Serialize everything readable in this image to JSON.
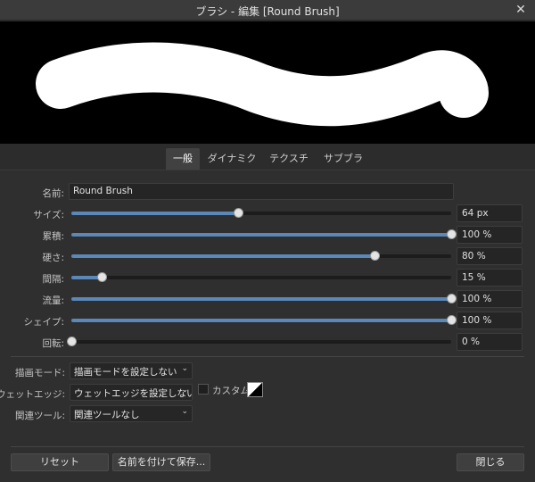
{
  "window": {
    "title": "ブラシ - 編集 [Round Brush]",
    "close_glyph": "✕"
  },
  "preview": {
    "stroke_color": "#ffffff",
    "background_color": "#000000"
  },
  "tabs": [
    {
      "label": "一般",
      "active": true
    },
    {
      "label": "ダイナミクス",
      "active": false
    },
    {
      "label": "テクスチャ",
      "active": false
    },
    {
      "label": "サブブラシ",
      "active": false
    }
  ],
  "general": {
    "name_label": "名前:",
    "name_value": "Round Brush",
    "sliders": [
      {
        "label": "サイズ:",
        "value": "64 px",
        "fraction": 0.44
      },
      {
        "label": "累積:",
        "value": "100 %",
        "fraction": 1.0
      },
      {
        "label": "硬さ:",
        "value": "80 %",
        "fraction": 0.8
      },
      {
        "label": "間隔:",
        "value": "15 %",
        "fraction": 0.08
      },
      {
        "label": "流量:",
        "value": "100 %",
        "fraction": 1.0
      },
      {
        "label": "シェイプ:",
        "value": "100 %",
        "fraction": 1.0
      },
      {
        "label": "回転:",
        "value": "0 %",
        "fraction": 0.0
      }
    ],
    "accent_color": "#5a88b8"
  },
  "options": {
    "blend_mode_label": "描画モード:",
    "blend_mode_value": "描画モードを設定しない",
    "wet_edges_label": "ウェットエッジ:",
    "wet_edges_value": "ウェットエッジを設定しない",
    "custom_label": "カスタム",
    "custom_checked": false,
    "related_tool_label": "関連ツール:",
    "related_tool_value": "関連ツールなし",
    "chevron_icon": "chevron-down-icon"
  },
  "footer": {
    "reset_label": "リセット",
    "save_as_label": "名前を付けて保存...",
    "close_label": "閉じる"
  }
}
